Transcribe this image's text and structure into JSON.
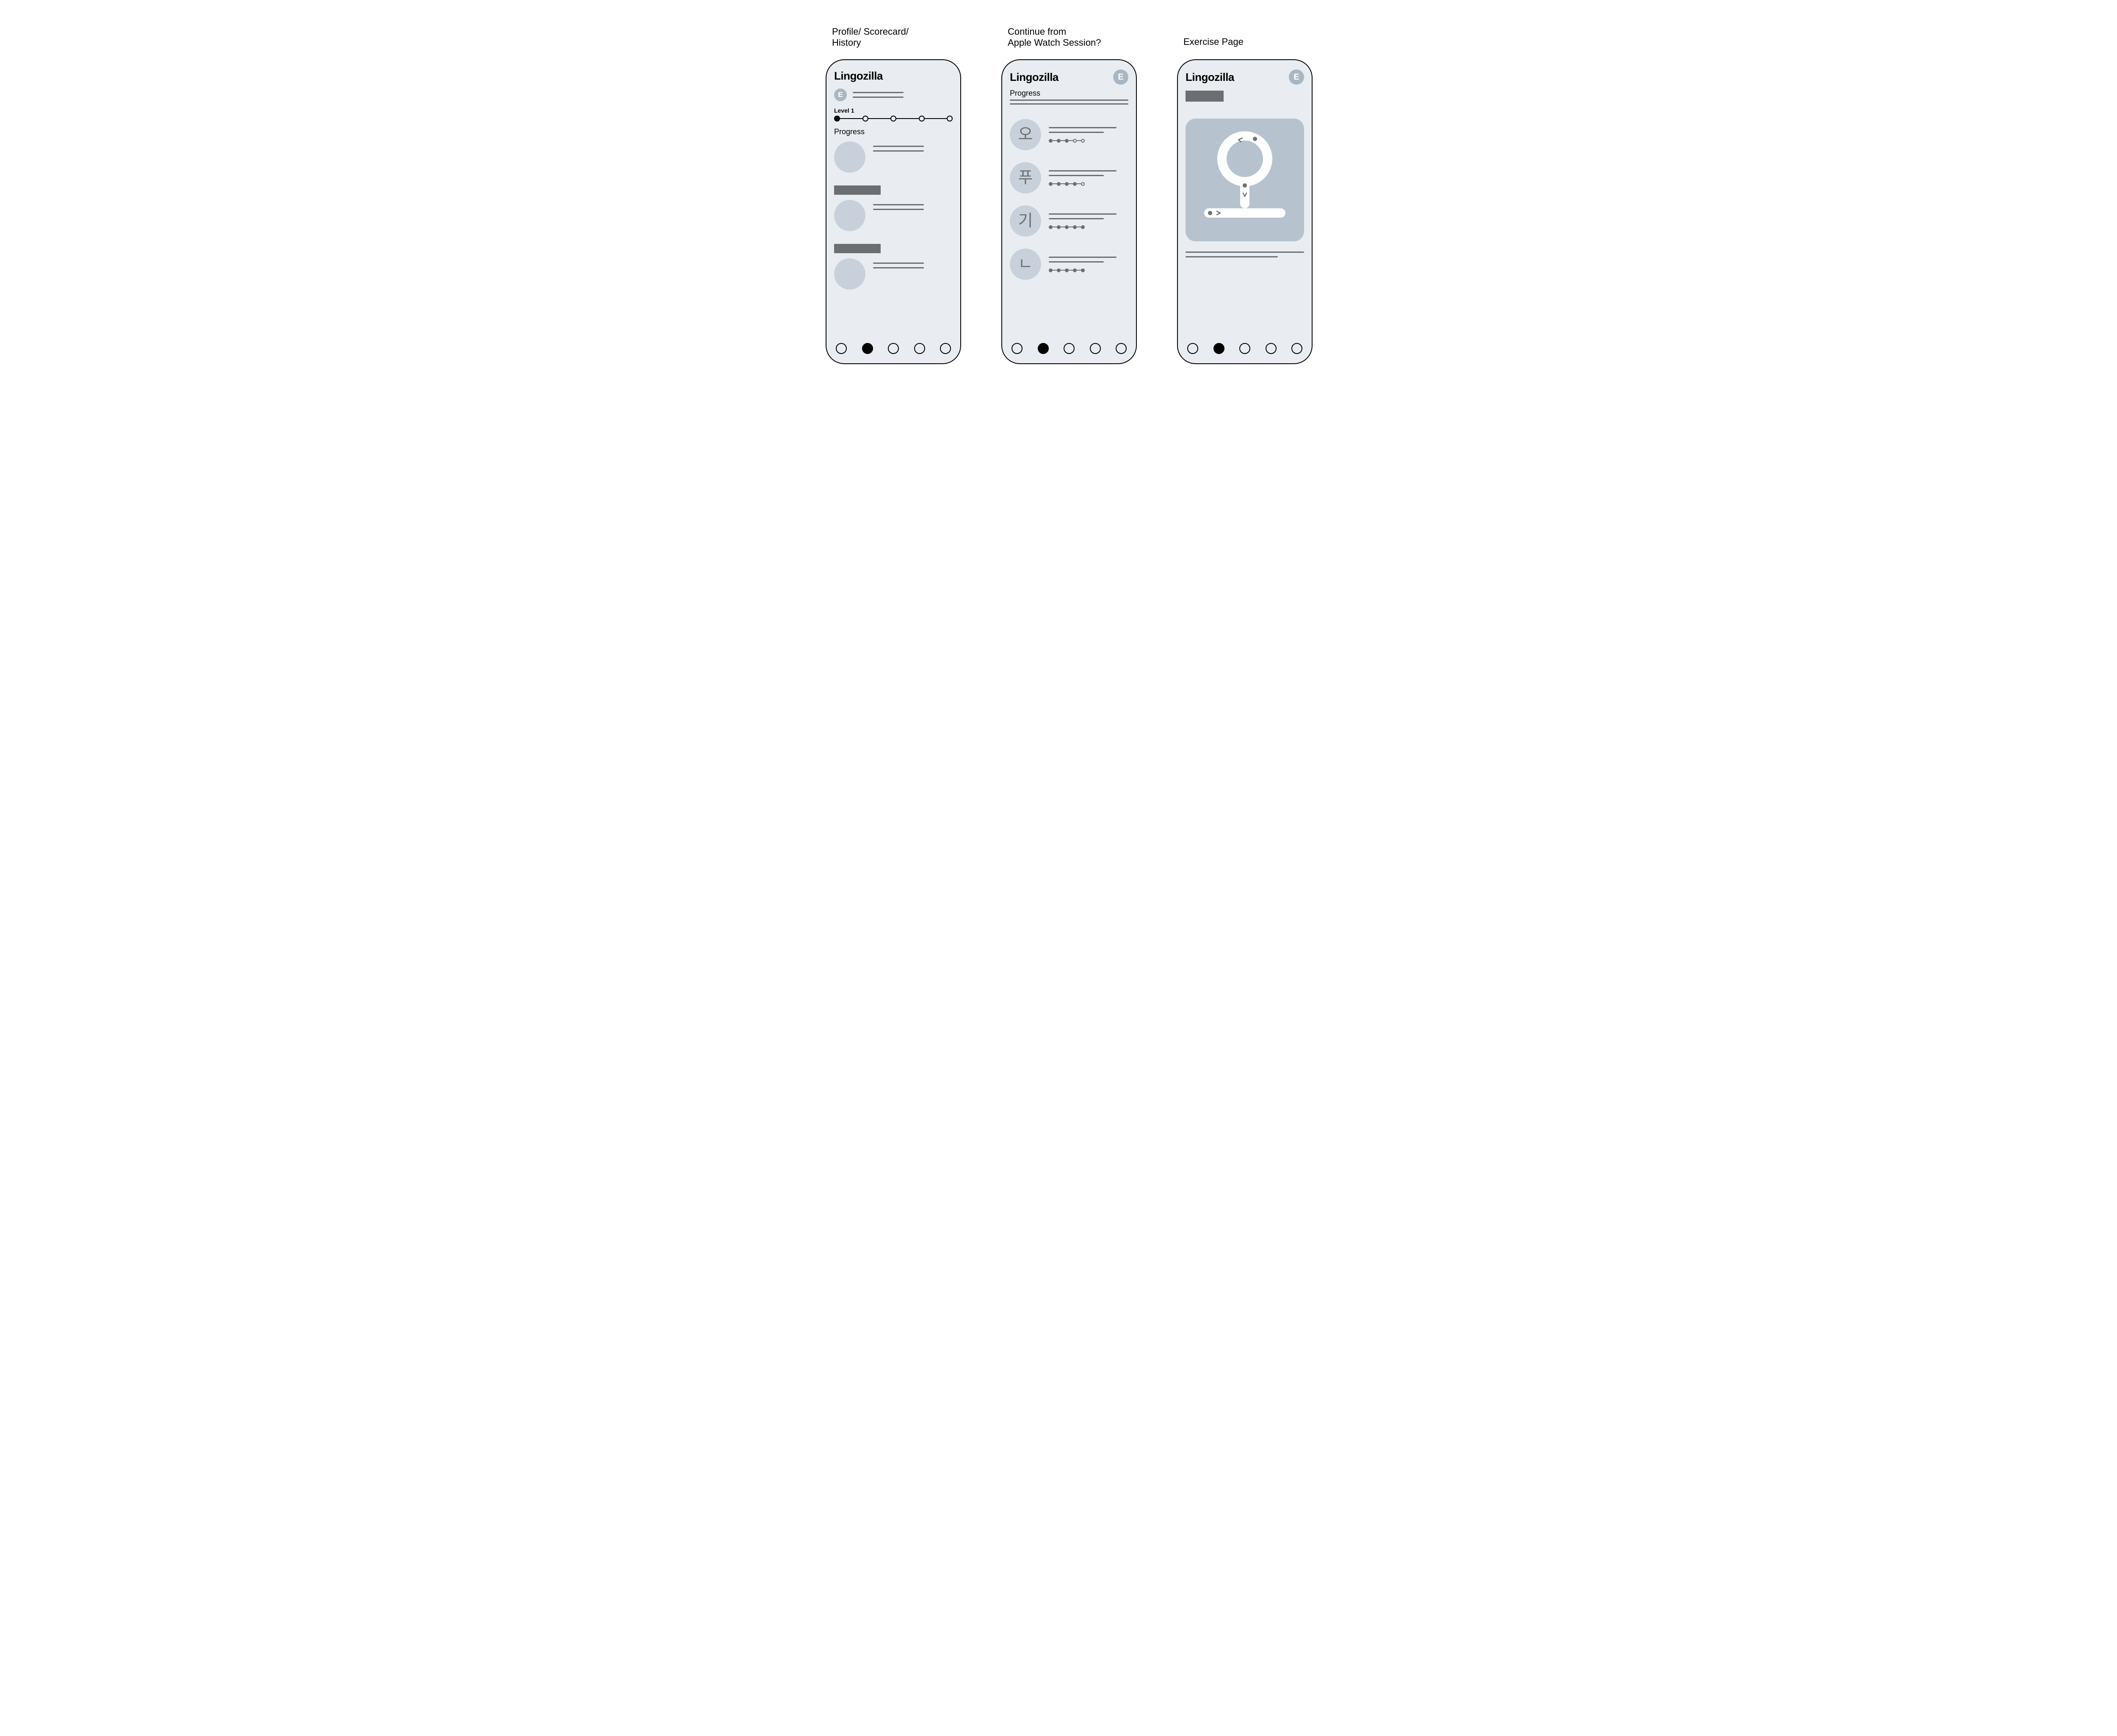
{
  "captions": {
    "screen1_line1": "Profile/ Scorecard/",
    "screen1_line2": "History",
    "screen2_line1": "Continue from",
    "screen2_line2": "Apple Watch Session?",
    "screen3": "Exercise Page"
  },
  "brand": "Lingozilla",
  "avatar_initial": "E",
  "screen1": {
    "level_label": "Level 1",
    "level_steps": 5,
    "level_current": 1,
    "progress_heading": "Progress"
  },
  "screen2": {
    "progress_heading": "Progress",
    "items": [
      {
        "glyph": "오",
        "step_count": 5,
        "filled": 3
      },
      {
        "glyph": "푸",
        "step_count": 5,
        "filled": 4
      },
      {
        "glyph": "기",
        "step_count": 5,
        "filled": 5
      },
      {
        "glyph": "ㄴ",
        "step_count": 5,
        "filled": 5
      }
    ]
  },
  "screen3": {
    "practice_glyph": "오"
  },
  "tabbar": {
    "count": 5,
    "active_index": 1
  },
  "colors": {
    "phone_bg": "#e9edf1",
    "placeholder_circle": "#c8d1db",
    "placeholder_line": "#6c6f72",
    "avatar_bg": "#aab6c4",
    "practice_card_bg": "#b7c2cf"
  }
}
